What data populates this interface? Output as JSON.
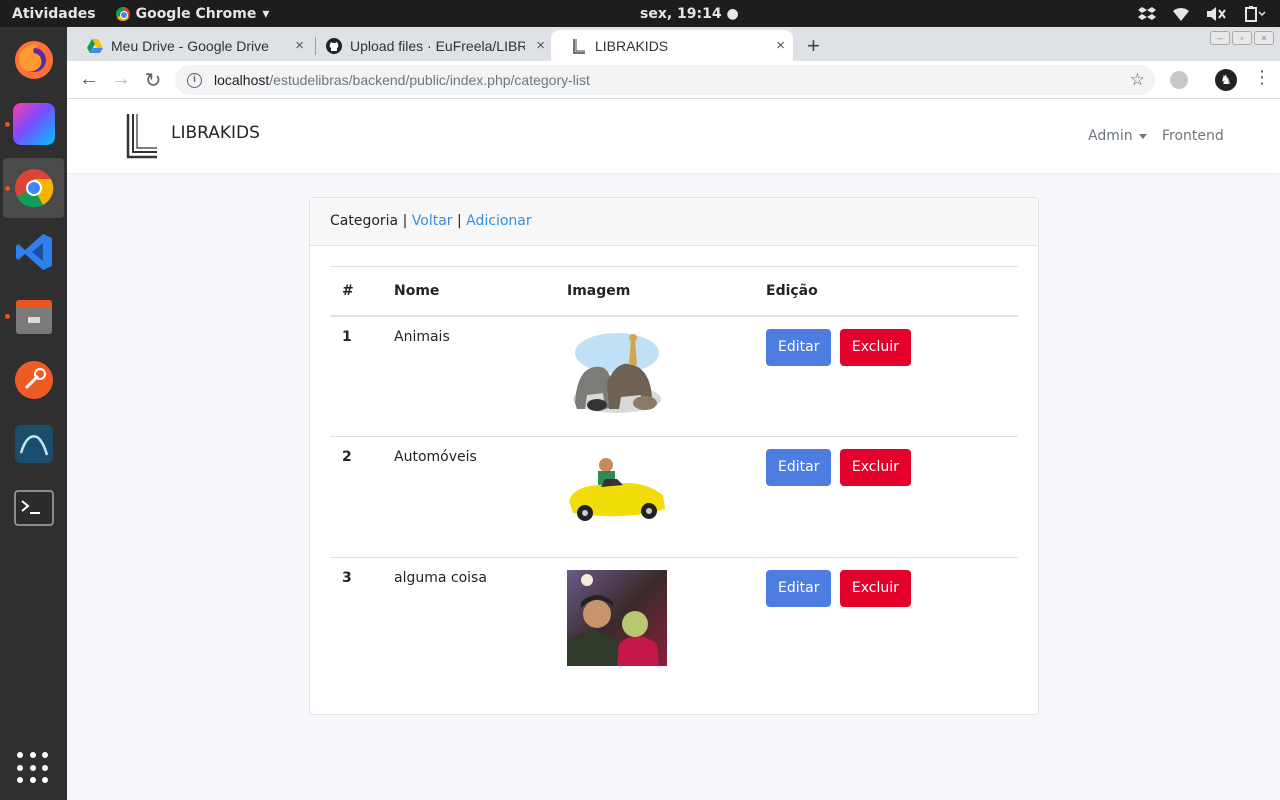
{
  "os": {
    "activities": "Atividades",
    "app_name": "Google Chrome",
    "clock": "sex, 19:14 ●"
  },
  "browser": {
    "tabs": [
      {
        "label": "Meu Drive - Google Drive",
        "close": "×"
      },
      {
        "label": "Upload files · EuFreela/LIBRAKIDS",
        "close": "×"
      },
      {
        "label": "LIBRAKIDS",
        "close": "×"
      }
    ],
    "new_tab": "+",
    "url_host": "localhost",
    "url_path": "/estudelibras/backend/public/index.php/category-list"
  },
  "navbar": {
    "brand": "LIBRAKIDS",
    "admin": "Admin",
    "frontend": "Frontend"
  },
  "card": {
    "header_title": "Categoria |",
    "back_link": "Voltar",
    "separator": "|",
    "add_link": "Adicionar"
  },
  "table": {
    "headers": [
      "#",
      "Nome",
      "Imagem",
      "Edição"
    ],
    "rows": [
      {
        "id": "1",
        "name": "Animais",
        "image": "animals-photo"
      },
      {
        "id": "2",
        "name": "Automóveis",
        "image": "toy-car-photo"
      },
      {
        "id": "3",
        "name": "alguma coisa",
        "image": "selfie-photo"
      }
    ],
    "edit_label": "Editar",
    "delete_label": "Excluir"
  },
  "colors": {
    "link": "#3490dc",
    "edit_button": "#4d7de0",
    "delete_button": "#e3002b"
  }
}
